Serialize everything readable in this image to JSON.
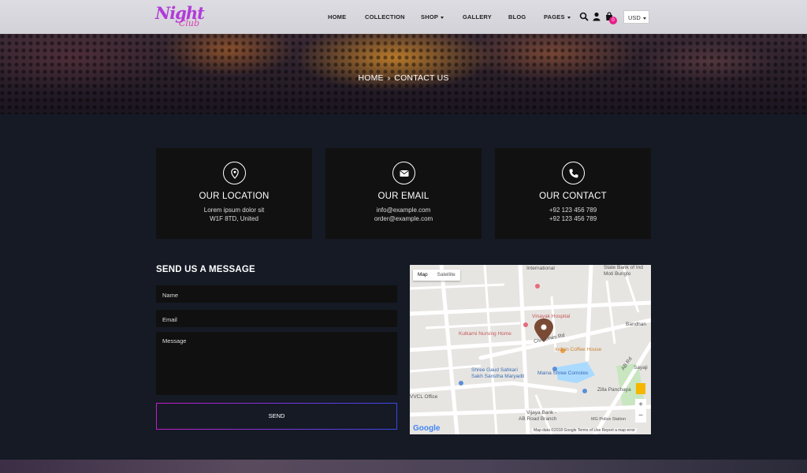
{
  "logo": {
    "line1": "Night",
    "line2": "Club"
  },
  "nav": {
    "home": "HOME",
    "collection": "COLLECTION",
    "shop": "SHOP",
    "gallery": "GALLERY",
    "blog": "BLOG",
    "pages": "PAGES"
  },
  "cart": {
    "count": "0"
  },
  "currency": {
    "selected": "USD"
  },
  "breadcrumb": {
    "home": "HOME",
    "separator": "›",
    "current": "CONTACT US"
  },
  "cards": {
    "location": {
      "title": "OUR LOCATION",
      "line1": "Lorem ipsum dolor sit",
      "line2": "W1F 8TD, United",
      "icon": "map-pin-icon"
    },
    "email": {
      "title": "OUR EMAIL",
      "line1": "info@example.com",
      "line2": "order@example.com",
      "icon": "envelope-icon"
    },
    "contact": {
      "title": "OUR CONTACT",
      "line1": "+92 123 456 789",
      "line2": "+92 123 456 789",
      "icon": "phone-icon"
    }
  },
  "form": {
    "title": "SEND US A MESSAGE",
    "name": "Name",
    "email": "Email",
    "message": "Message",
    "send": "SEND"
  },
  "map": {
    "tab_map": "Map",
    "tab_satellite": "Satellite",
    "labels": {
      "international": "International",
      "state_bank": "State Bank of Ind",
      "moti_bunglow": "Moti Bunglo",
      "vinayak": "Vinayak Hospital",
      "kulkarni": "Kulkarni Nursing Home",
      "civil_lines": "Civil Lines Rd",
      "indian_coffee": "Indian Coffee House",
      "shree_gaud": "Shree Gaud Sahkari",
      "sakh": "Sakh Sanstha Maryadit",
      "maina": "Maina Shree Comolex",
      "vvcl": "VVCL Office",
      "vijaya": "Vijaya Bank -",
      "ab_road_branch": "AB Road Branch",
      "zilla": "Zilla Panchaya",
      "mg_police": "MG Police Station",
      "ab_rd": "AB Rd",
      "bandhan": "Bandhan",
      "sayaji": "Sayaji",
      "google": "Google"
    },
    "footer": "Map data ©2018 Google   Terms of Use   Report a map error",
    "zoom_in": "+",
    "zoom_out": "−"
  }
}
